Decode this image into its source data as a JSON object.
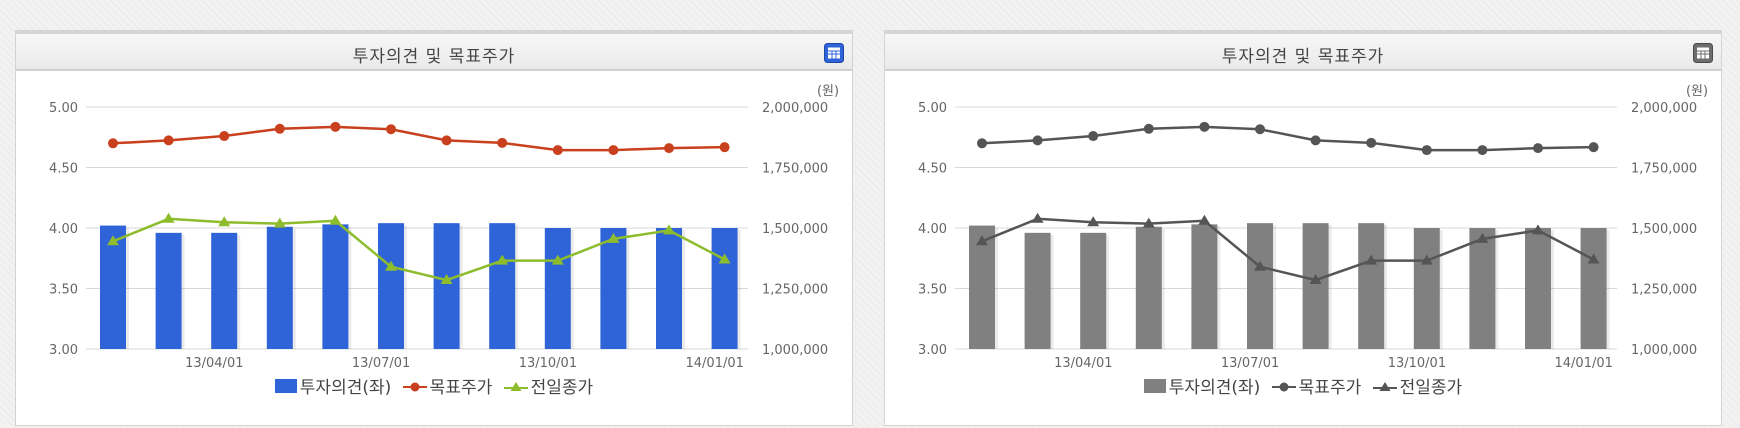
{
  "chart_data": [
    {
      "type": "bar",
      "title": "투자의견 및 목표주가",
      "unit_right": "(원)",
      "x_ticks": [
        "13/04/01",
        "13/07/01",
        "13/10/01",
        "14/01/01"
      ],
      "ylim_left": [
        3.0,
        5.0
      ],
      "yticks_left": [
        "5.00",
        "4.50",
        "4.00",
        "3.50",
        "3.00"
      ],
      "ylim_right": [
        1000000,
        2000000
      ],
      "yticks_right": [
        "2,000,000",
        "1,750,000",
        "1,500,000",
        "1,250,000",
        "1,000,000"
      ],
      "grid": true,
      "legend_position": "bottom",
      "colors": {
        "bar": "#2f63d8",
        "target": "#c8401e",
        "close": "#8dbd2c"
      },
      "series": [
        {
          "name": "투자의견(좌)",
          "type": "bar",
          "axis": "left",
          "values": [
            4.02,
            3.96,
            3.96,
            4.01,
            4.03,
            4.04,
            4.04,
            4.04,
            4.0,
            4.0,
            4.0,
            4.0
          ]
        },
        {
          "name": "목표주가",
          "type": "line",
          "axis": "right",
          "marker": "circle",
          "values": [
            1850000,
            1862000,
            1880000,
            1910000,
            1918000,
            1908000,
            1862000,
            1852000,
            1822000,
            1822000,
            1830000,
            1834000
          ]
        },
        {
          "name": "전일종가",
          "type": "line",
          "axis": "right",
          "marker": "triangle",
          "values": [
            1445000,
            1538000,
            1524000,
            1518000,
            1530000,
            1340000,
            1285000,
            1365000,
            1365000,
            1455000,
            1490000,
            1370000
          ]
        }
      ]
    },
    {
      "type": "bar",
      "title": "투자의견 및 목표주가",
      "unit_right": "(원)",
      "x_ticks": [
        "13/04/01",
        "13/07/01",
        "13/10/01",
        "14/01/01"
      ],
      "ylim_left": [
        3.0,
        5.0
      ],
      "yticks_left": [
        "5.00",
        "4.50",
        "4.00",
        "3.50",
        "3.00"
      ],
      "ylim_right": [
        1000000,
        2000000
      ],
      "yticks_right": [
        "2,000,000",
        "1,750,000",
        "1,500,000",
        "1,250,000",
        "1,000,000"
      ],
      "grid": true,
      "legend_position": "bottom",
      "colors": {
        "bar": "#808080",
        "target": "#555555",
        "close": "#555555"
      },
      "series": [
        {
          "name": "투자의견(좌)",
          "type": "bar",
          "axis": "left",
          "values": [
            4.02,
            3.96,
            3.96,
            4.01,
            4.03,
            4.04,
            4.04,
            4.04,
            4.0,
            4.0,
            4.0,
            4.0
          ]
        },
        {
          "name": "목표주가",
          "type": "line",
          "axis": "right",
          "marker": "circle",
          "values": [
            1850000,
            1862000,
            1880000,
            1910000,
            1918000,
            1908000,
            1862000,
            1852000,
            1822000,
            1822000,
            1830000,
            1834000
          ]
        },
        {
          "name": "전일종가",
          "type": "line",
          "axis": "right",
          "marker": "triangle",
          "values": [
            1445000,
            1538000,
            1524000,
            1518000,
            1530000,
            1340000,
            1285000,
            1365000,
            1365000,
            1455000,
            1490000,
            1370000
          ]
        }
      ]
    }
  ],
  "panels": [
    {
      "icon": "table-icon",
      "icon_color": "#2f63d8"
    },
    {
      "icon": "table-icon",
      "icon_color": "#6d6d6d"
    }
  ]
}
